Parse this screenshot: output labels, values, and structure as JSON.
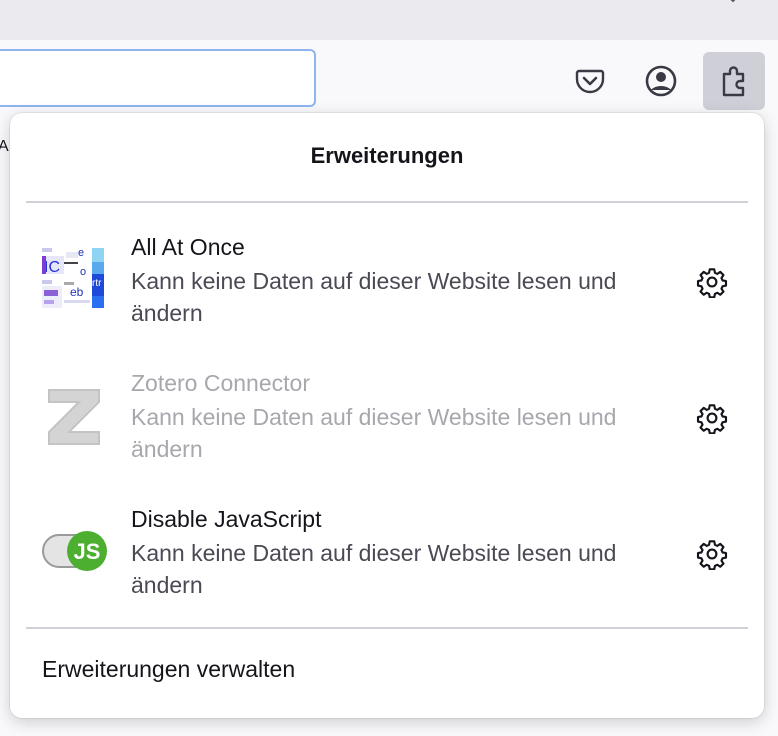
{
  "toolbar": {
    "pocket_icon": "pocket-icon",
    "account_icon": "account-icon",
    "extensions_icon": "puzzle-piece-icon",
    "bookmark_fragment": "A"
  },
  "panel": {
    "title": "Erweiterungen",
    "extensions": [
      {
        "name": "All At Once",
        "description": "Kann keine Daten auf dieser Website lesen und ändern",
        "enabled": true,
        "icon": "all-at-once-icon"
      },
      {
        "name": "Zotero Connector",
        "description": "Kann keine Daten auf dieser Website lesen und ändern",
        "enabled": false,
        "icon": "zotero-z-icon"
      },
      {
        "name": "Disable JavaScript",
        "description": "Kann keine Daten auf dieser Website lesen und ändern",
        "enabled": true,
        "icon": "js-toggle-icon"
      }
    ],
    "manage_label": "Erweiterungen verwalten"
  },
  "colors": {
    "accent_focus": "#8fb4ef",
    "js_green": "#4caf2f",
    "disabled_text": "#a7a7ad"
  }
}
